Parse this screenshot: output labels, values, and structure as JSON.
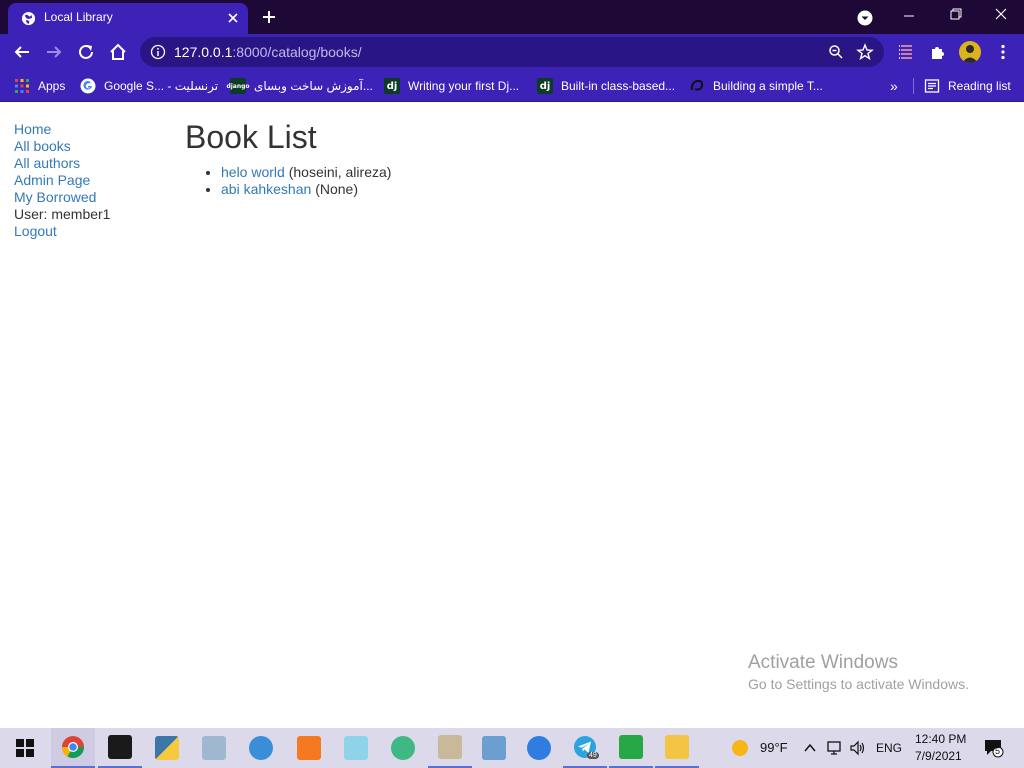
{
  "browser": {
    "tab_title": "Local Library",
    "url_host": "127.0.0.1",
    "url_rest": ":8000/catalog/books/"
  },
  "bookmarks": [
    {
      "label": "Apps",
      "icon": "apps-grid-icon"
    },
    {
      "label": "Google S... - ترنسلیت",
      "icon": "google-icon"
    },
    {
      "label": "آموزش ساخت وبسای...",
      "icon": "django-icon"
    },
    {
      "label": "Writing your first Dj...",
      "icon": "dj-icon"
    },
    {
      "label": "Built-in class-based...",
      "icon": "dj-icon"
    },
    {
      "label": "Building a simple T...",
      "icon": "swirl-icon"
    }
  ],
  "reading_list": "Reading list",
  "sidebar": {
    "home": "Home",
    "all_books": "All books",
    "all_authors": "All authors",
    "admin_page": "Admin Page",
    "my_borrowed": "My Borrowed",
    "user": "User: member1",
    "logout": "Logout"
  },
  "main": {
    "title": "Book List",
    "books": [
      {
        "title": "helo world",
        "author": "(hoseini, alireza)"
      },
      {
        "title": "abi kahkeshan",
        "author": "(None)"
      }
    ]
  },
  "watermark": {
    "title": "Activate Windows",
    "subtitle": "Go to Settings to activate Windows."
  },
  "taskbar": {
    "weather": "99°F",
    "language": "ENG",
    "time": "12:40 PM",
    "date": "7/9/2021",
    "notifications": "5",
    "telegram_badge": "49"
  },
  "colors": {
    "chrome_dark": "#1d0836",
    "chrome_accent": "#3d22b8",
    "link": "#337ab7",
    "text": "#333333"
  }
}
